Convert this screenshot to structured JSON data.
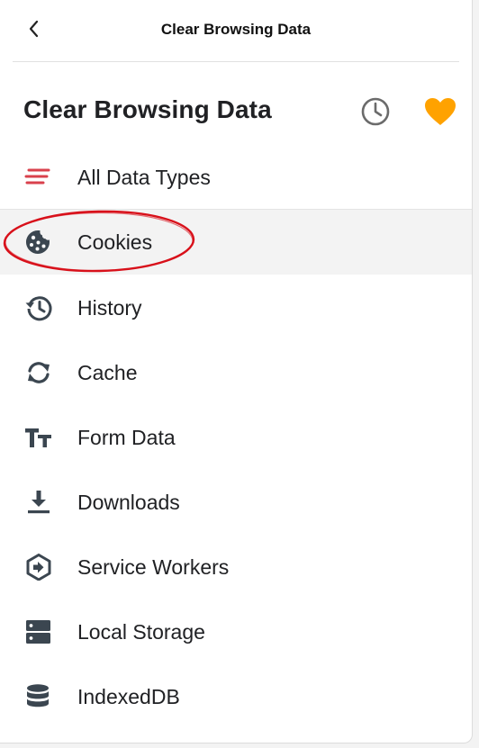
{
  "topbar": {
    "title": "Clear Browsing Data"
  },
  "header": {
    "title": "Clear Browsing Data"
  },
  "colors": {
    "accent_red": "#d9414c",
    "favorite_orange": "#ffa200",
    "icon_dark": "#3b4650",
    "annotation_red": "#d8101a"
  },
  "items": [
    {
      "label": "All Data Types",
      "icon": "lines-icon"
    },
    {
      "label": "Cookies",
      "icon": "cookie-icon",
      "selected": true
    },
    {
      "label": "History",
      "icon": "history-icon"
    },
    {
      "label": "Cache",
      "icon": "refresh-icon"
    },
    {
      "label": "Form Data",
      "icon": "text-size-icon"
    },
    {
      "label": "Downloads",
      "icon": "download-icon"
    },
    {
      "label": "Service Workers",
      "icon": "service-worker-icon"
    },
    {
      "label": "Local Storage",
      "icon": "storage-icon"
    },
    {
      "label": "IndexedDB",
      "icon": "database-icon"
    }
  ]
}
